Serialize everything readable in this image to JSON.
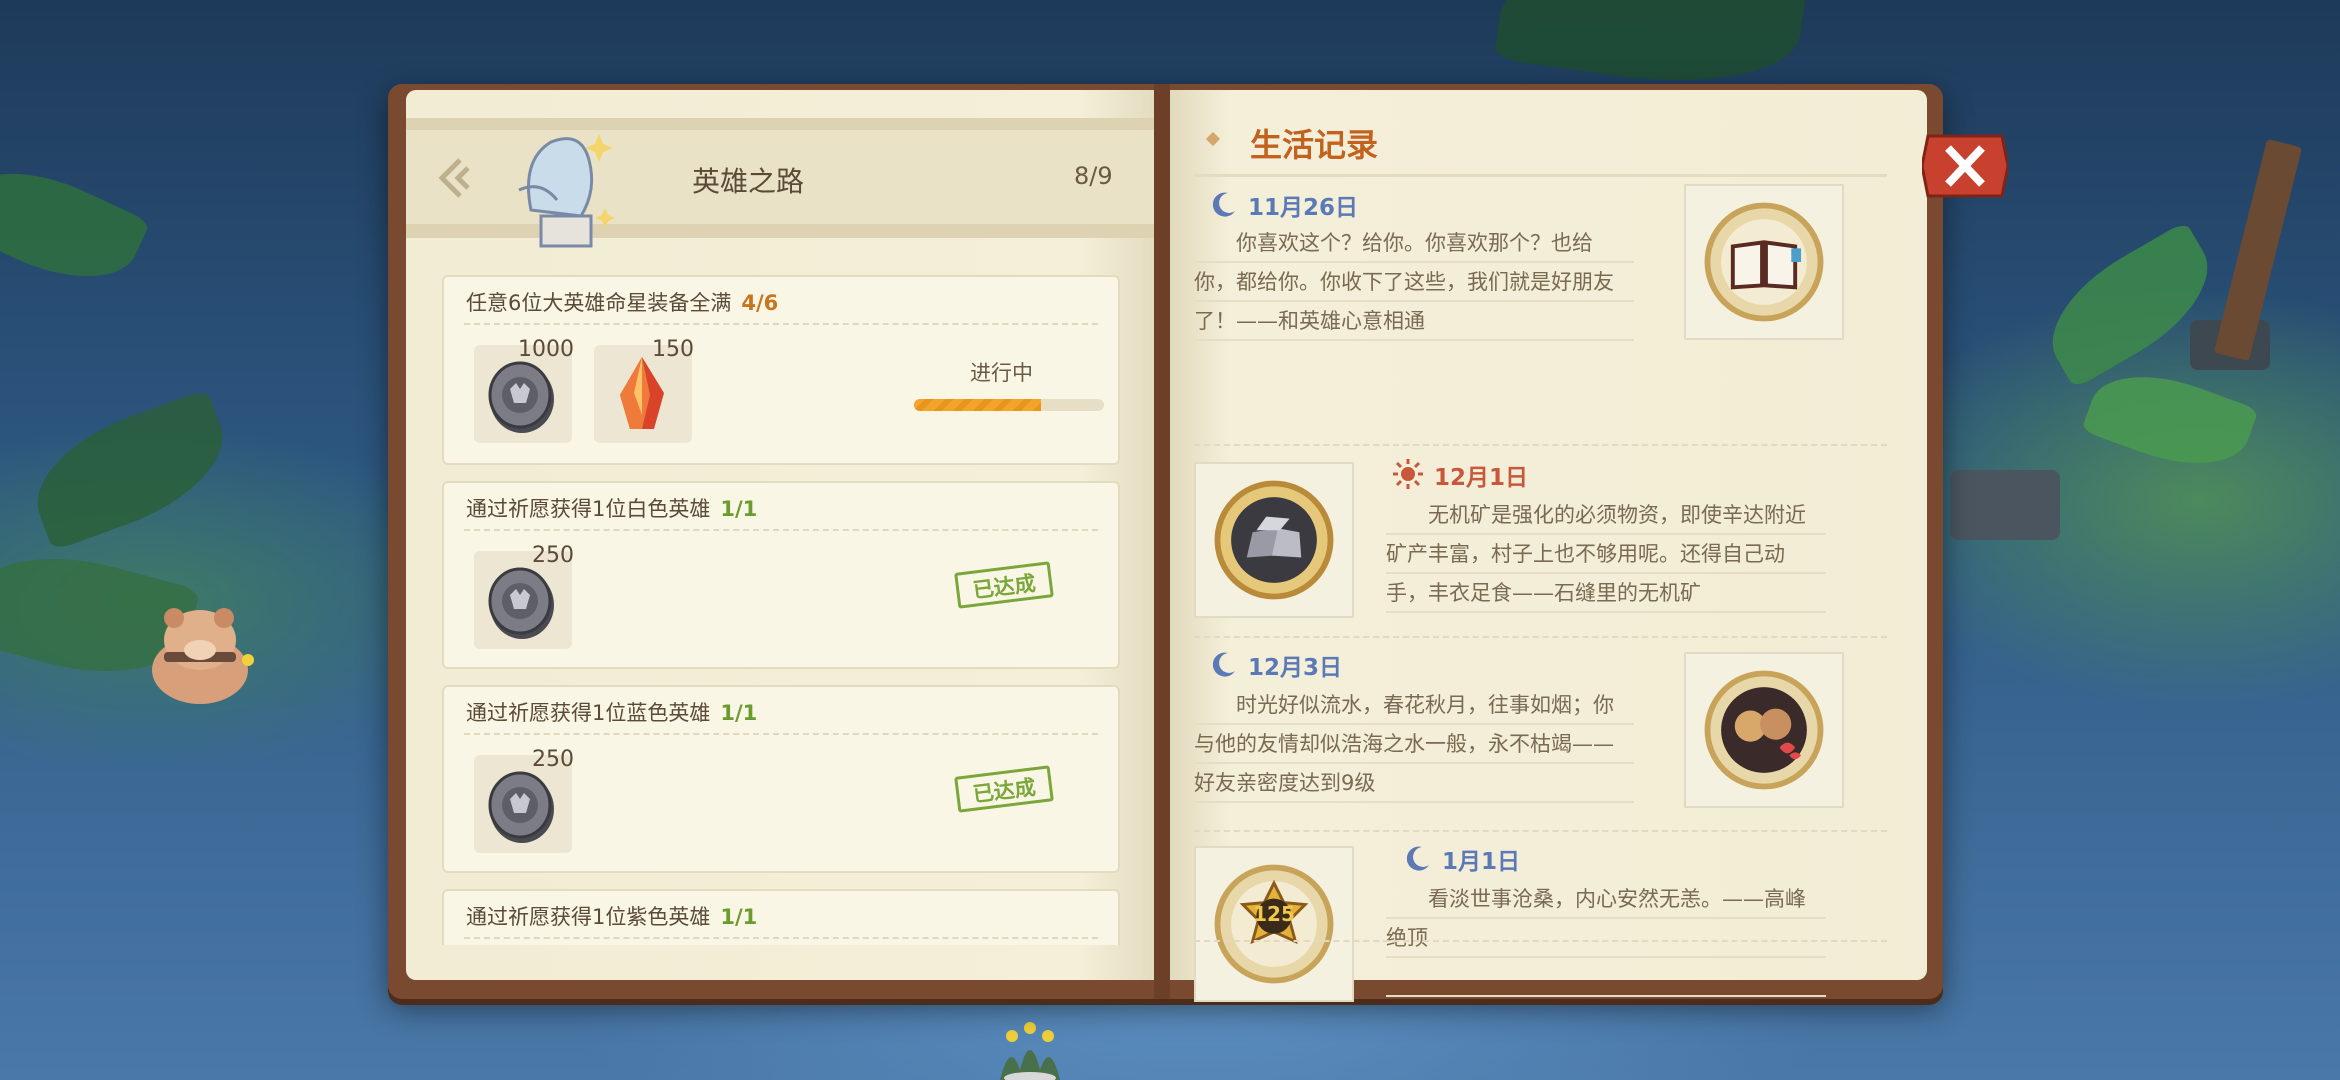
{
  "hero_road": {
    "title": "英雄之路",
    "progress": "8/9",
    "tasks": [
      {
        "title": "任意6位大英雄命星装备全满",
        "count": "4/6",
        "rewards": [
          {
            "icon": "coin-icon",
            "amount": "1000"
          },
          {
            "icon": "red-crystal-icon",
            "amount": "150"
          }
        ],
        "status": "进行中",
        "progress_fraction": 0.667
      },
      {
        "title": "通过祈愿获得1位白色英雄",
        "count": "1/1",
        "rewards": [
          {
            "icon": "coin-icon",
            "amount": "250"
          }
        ],
        "status": "已达成"
      },
      {
        "title": "通过祈愿获得1位蓝色英雄",
        "count": "1/1",
        "rewards": [
          {
            "icon": "coin-icon",
            "amount": "250"
          }
        ],
        "status": "已达成"
      },
      {
        "title": "通过祈愿获得1位紫色英雄",
        "count": "1/1"
      }
    ]
  },
  "life_record": {
    "title": "生活记录",
    "entries": [
      {
        "date": "11月26日",
        "time_icon": "moon-icon",
        "text": "你喜欢这个？给你。你喜欢那个？也给你，都给你。你收下了这些，我们就是好朋友了！——和英雄心意相通",
        "medal": "book-medal-icon"
      },
      {
        "date": "12月1日",
        "time_icon": "sun-icon",
        "text": "无机矿是强化的必须物资，即使辛达附近矿产丰富，村子上也不够用呢。还得自己动手，丰衣足食——石缝里的无机矿",
        "medal": "ore-medal-icon"
      },
      {
        "date": "12月3日",
        "time_icon": "moon-icon",
        "text": "时光好似流水，春花秋月，往事如烟；你与他的友情却似浩海之水一般，永不枯竭——好友亲密度达到9级",
        "medal": "friends-medal-icon"
      },
      {
        "date": "1月1日",
        "time_icon": "moon-icon",
        "text": "看淡世事沧桑，内心安然无恙。——高峰绝顶",
        "medal": "level-125-medal-icon",
        "medal_number": "125"
      }
    ]
  },
  "colors": {
    "accent_orange": "#c2621e",
    "moon_blue": "#5a79b6",
    "sun_red": "#c8583c",
    "done_green": "#7aa63a",
    "close_red": "#c8412e"
  }
}
